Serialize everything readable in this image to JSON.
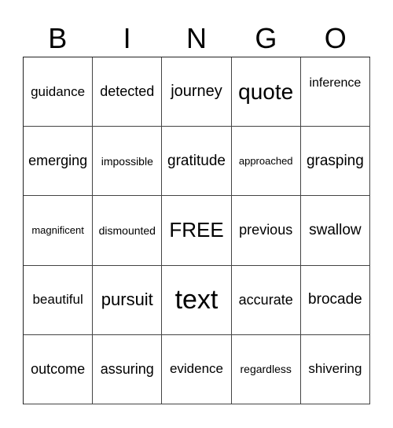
{
  "header": {
    "letters": [
      "B",
      "I",
      "N",
      "G",
      "O"
    ]
  },
  "board": {
    "rows": [
      [
        "guidance",
        "detected",
        "journey",
        "quote",
        "inference"
      ],
      [
        "emerging",
        "impossible",
        "gratitude",
        "approached",
        "grasping"
      ],
      [
        "magnificent",
        "dismounted",
        "FREE",
        "previous",
        "swallow"
      ],
      [
        "beautiful",
        "pursuit",
        "text",
        "accurate",
        "brocade"
      ],
      [
        "outcome",
        "assuring",
        "evidence",
        "regardless",
        "shivering"
      ]
    ]
  }
}
